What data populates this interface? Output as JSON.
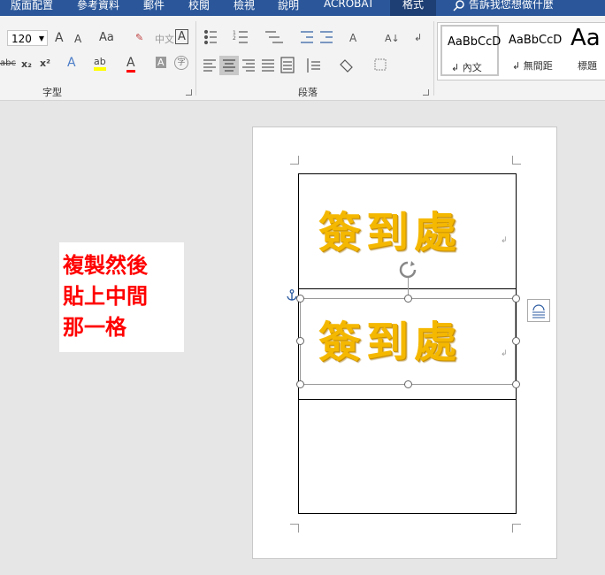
{
  "menu": {
    "tabs": [
      "版面配置",
      "參考資料",
      "郵件",
      "校閱",
      "檢視",
      "說明",
      "ACROBAT",
      "格式"
    ],
    "active_tab": "格式",
    "tell_me": "告訴我您想做什麼"
  },
  "ribbon": {
    "font": {
      "size_value": "120",
      "group_label": "字型",
      "buttons": [
        "A",
        "A",
        "Aa",
        "中文",
        "A",
        "abc",
        "x₂",
        "x²",
        "A",
        "ab",
        "A",
        "A",
        "字"
      ]
    },
    "paragraph": {
      "group_label": "段落"
    },
    "styles": {
      "items": [
        {
          "sample": "AaBbCcD",
          "label": "內文"
        },
        {
          "sample": "AaBbCcD",
          "label": "無間距"
        },
        {
          "sample": "Aa",
          "label": "標題"
        }
      ]
    }
  },
  "document": {
    "cells": [
      {
        "text": "簽到處"
      },
      {
        "text": "簽到處"
      },
      {
        "text": ""
      }
    ]
  },
  "annotation": {
    "lines": [
      "複製然後",
      "貼上中間",
      "那一格"
    ],
    "color": "#ff0000"
  },
  "colors": {
    "menubar": "#2b579a",
    "sign_text": "#f5b800",
    "highlight": "#ffff00",
    "font_color": "#ff0000"
  }
}
